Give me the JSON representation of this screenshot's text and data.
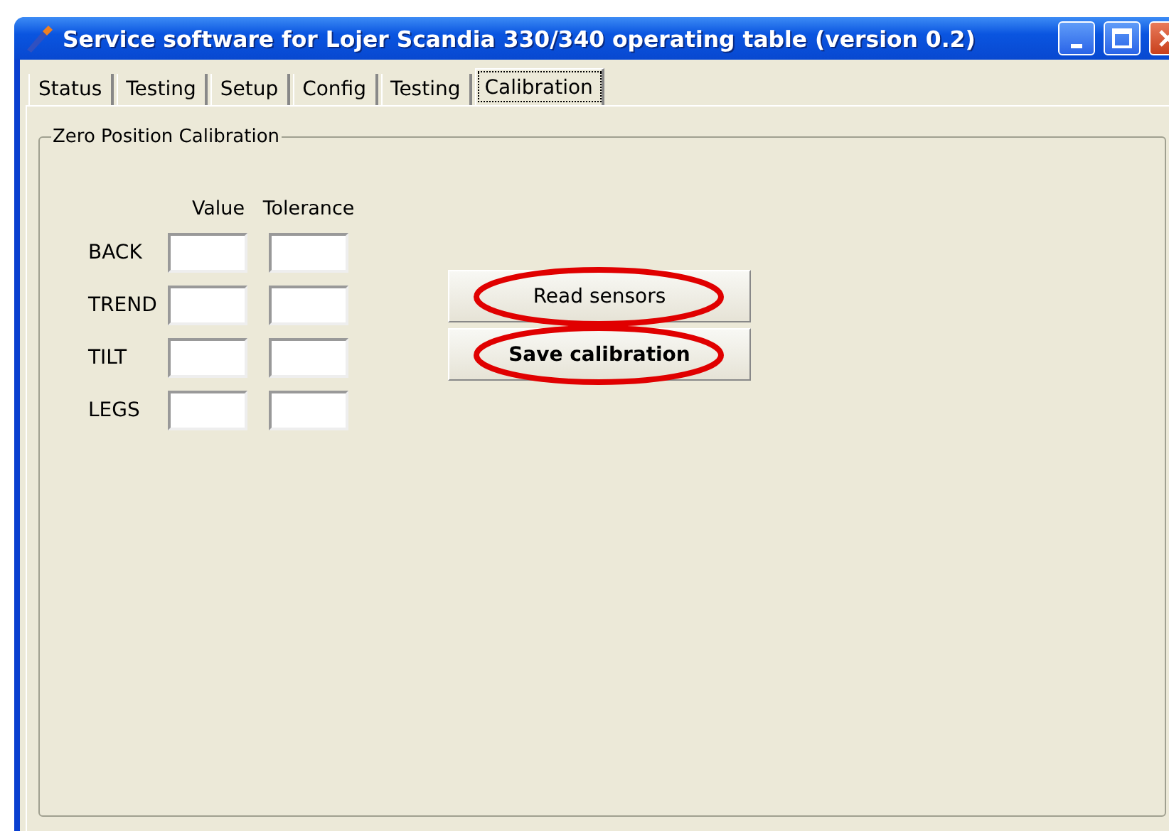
{
  "window": {
    "title": "Service software for Lojer Scandia 330/340 operating table (version 0.2)"
  },
  "tabs": [
    {
      "label": "Status",
      "selected": false
    },
    {
      "label": "Testing",
      "selected": false
    },
    {
      "label": "Setup",
      "selected": false
    },
    {
      "label": "Config",
      "selected": false
    },
    {
      "label": "Testing",
      "selected": false
    },
    {
      "label": "Calibration",
      "selected": true
    }
  ],
  "group": {
    "title": "Zero Position Calibration",
    "columns": [
      "Value",
      "Tolerance"
    ],
    "rows": [
      {
        "label": "BACK"
      },
      {
        "label": "TREND"
      },
      {
        "label": "TILT"
      },
      {
        "label": "LEGS"
      }
    ]
  },
  "buttons": [
    {
      "label": "Read sensors",
      "bold": false,
      "circled": true
    },
    {
      "label": "Save calibration",
      "bold": true,
      "circled": true
    }
  ]
}
